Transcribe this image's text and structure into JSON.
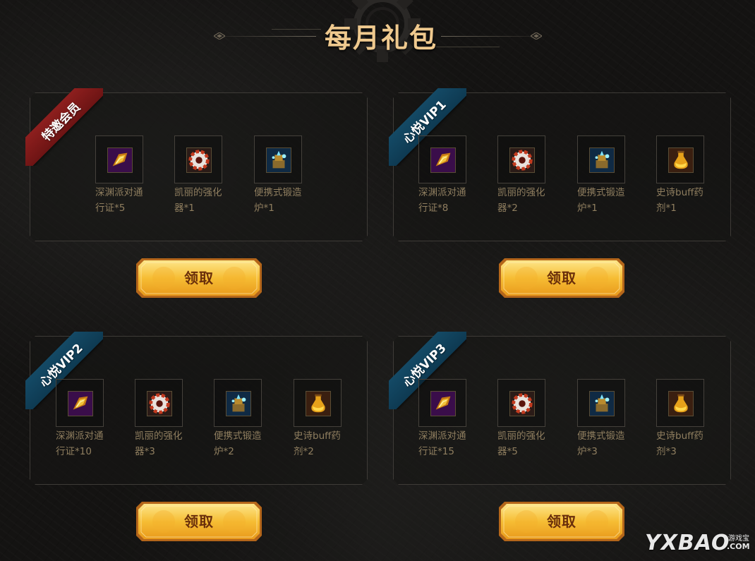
{
  "header": {
    "title": "每月礼包"
  },
  "packages": [
    {
      "tier": "特邀会员",
      "ribbon_color": "#7d1a1a",
      "claim_label": "领取",
      "items": [
        {
          "icon": "abyss-pass-icon",
          "name": "深渊派对通行证*5"
        },
        {
          "icon": "kelly-amplifier-icon",
          "name": "凯丽的强化器*1"
        },
        {
          "icon": "portable-forge-icon",
          "name": "便携式锻造炉*1"
        }
      ]
    },
    {
      "tier": "心悦VIP1",
      "ribbon_color": "#0f3d56",
      "claim_label": "领取",
      "items": [
        {
          "icon": "abyss-pass-icon",
          "name": "深渊派对通行证*8"
        },
        {
          "icon": "kelly-amplifier-icon",
          "name": "凯丽的强化器*2"
        },
        {
          "icon": "portable-forge-icon",
          "name": "便携式锻造炉*1"
        },
        {
          "icon": "epic-buff-potion-icon",
          "name": "史诗buff药剂*1"
        }
      ]
    },
    {
      "tier": "心悦VIP2",
      "ribbon_color": "#0f3d56",
      "claim_label": "领取",
      "items": [
        {
          "icon": "abyss-pass-icon",
          "name": "深渊派对通行证*10"
        },
        {
          "icon": "kelly-amplifier-icon",
          "name": "凯丽的强化器*3"
        },
        {
          "icon": "portable-forge-icon",
          "name": "便携式锻造炉*2"
        },
        {
          "icon": "epic-buff-potion-icon",
          "name": "史诗buff药剂*2"
        }
      ]
    },
    {
      "tier": "心悦VIP3",
      "ribbon_color": "#0f3d56",
      "claim_label": "领取",
      "items": [
        {
          "icon": "abyss-pass-icon",
          "name": "深渊派对通行证*15"
        },
        {
          "icon": "kelly-amplifier-icon",
          "name": "凯丽的强化器*5"
        },
        {
          "icon": "portable-forge-icon",
          "name": "便携式锻造炉*3"
        },
        {
          "icon": "epic-buff-potion-icon",
          "name": "史诗buff药剂*3"
        }
      ]
    }
  ],
  "watermark": {
    "brand": "YXBAO",
    "sub": "游戏宝",
    "domain": ".COM"
  },
  "colors": {
    "title_gold": "#efc98e",
    "button_gold": "#f5b932",
    "button_text": "#6a2f0b",
    "item_text": "#8f7e5f"
  }
}
